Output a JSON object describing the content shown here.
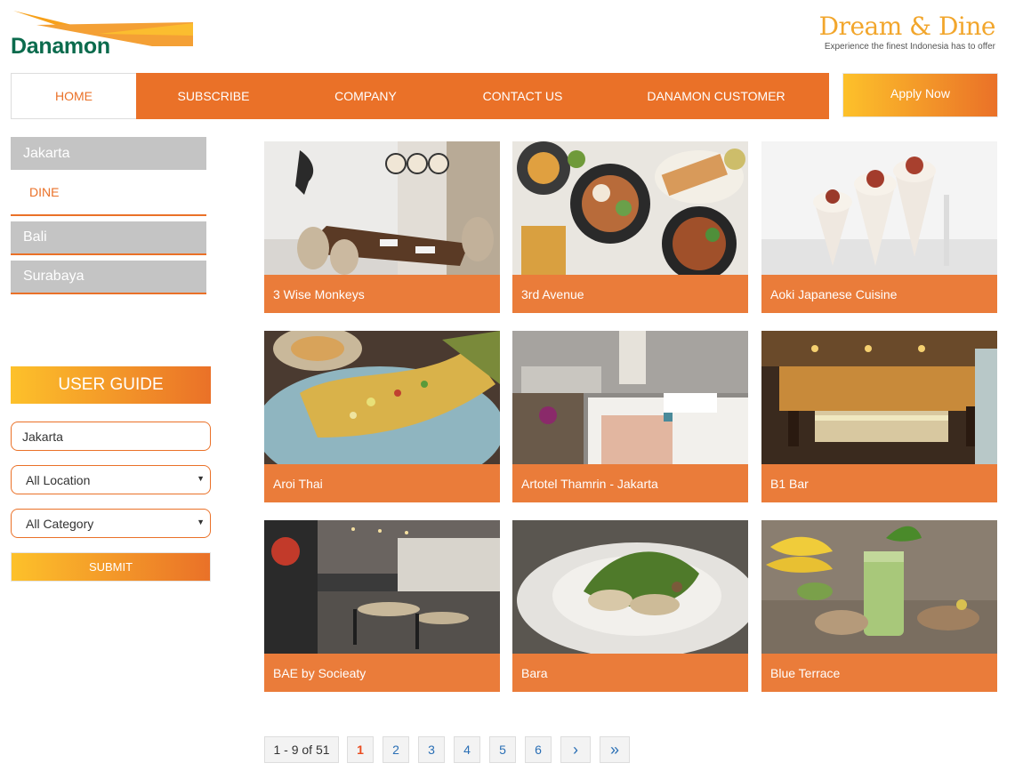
{
  "header": {
    "logo_text": "Danamon",
    "brand_title": "Dream & Dine",
    "brand_subtitle": "Experience the finest Indonesia has to offer"
  },
  "nav": {
    "items": [
      {
        "label": "HOME"
      },
      {
        "label": "SUBSCRIBE"
      },
      {
        "label": "COMPANY"
      },
      {
        "label": "CONTACT US"
      },
      {
        "label": "DANAMON CUSTOMER"
      }
    ],
    "apply_label": "Apply Now"
  },
  "sidebar": {
    "cities": [
      "Jakarta",
      "Bali",
      "Surabaya"
    ],
    "sub_item": "DINE",
    "guide_label": "USER GUIDE",
    "city_input_value": "Jakarta",
    "location_select": "All Location",
    "category_select": "All Category",
    "submit_label": "SUBMIT"
  },
  "restaurants": [
    {
      "name": "3 Wise Monkeys"
    },
    {
      "name": "3rd Avenue"
    },
    {
      "name": "Aoki Japanese Cuisine"
    },
    {
      "name": "Aroi Thai"
    },
    {
      "name": "Artotel Thamrin - Jakarta"
    },
    {
      "name": "B1 Bar"
    },
    {
      "name": "BAE by Socieaty"
    },
    {
      "name": "Bara"
    },
    {
      "name": "Blue Terrace"
    }
  ],
  "pagination": {
    "info": "1 - 9 of 51",
    "pages": [
      "1",
      "2",
      "3",
      "4",
      "5",
      "6"
    ],
    "next": "›",
    "last": "»"
  },
  "colors": {
    "accent": "#ea7128",
    "brand_green": "#0b6b4d",
    "gold": "#f2a62c"
  }
}
